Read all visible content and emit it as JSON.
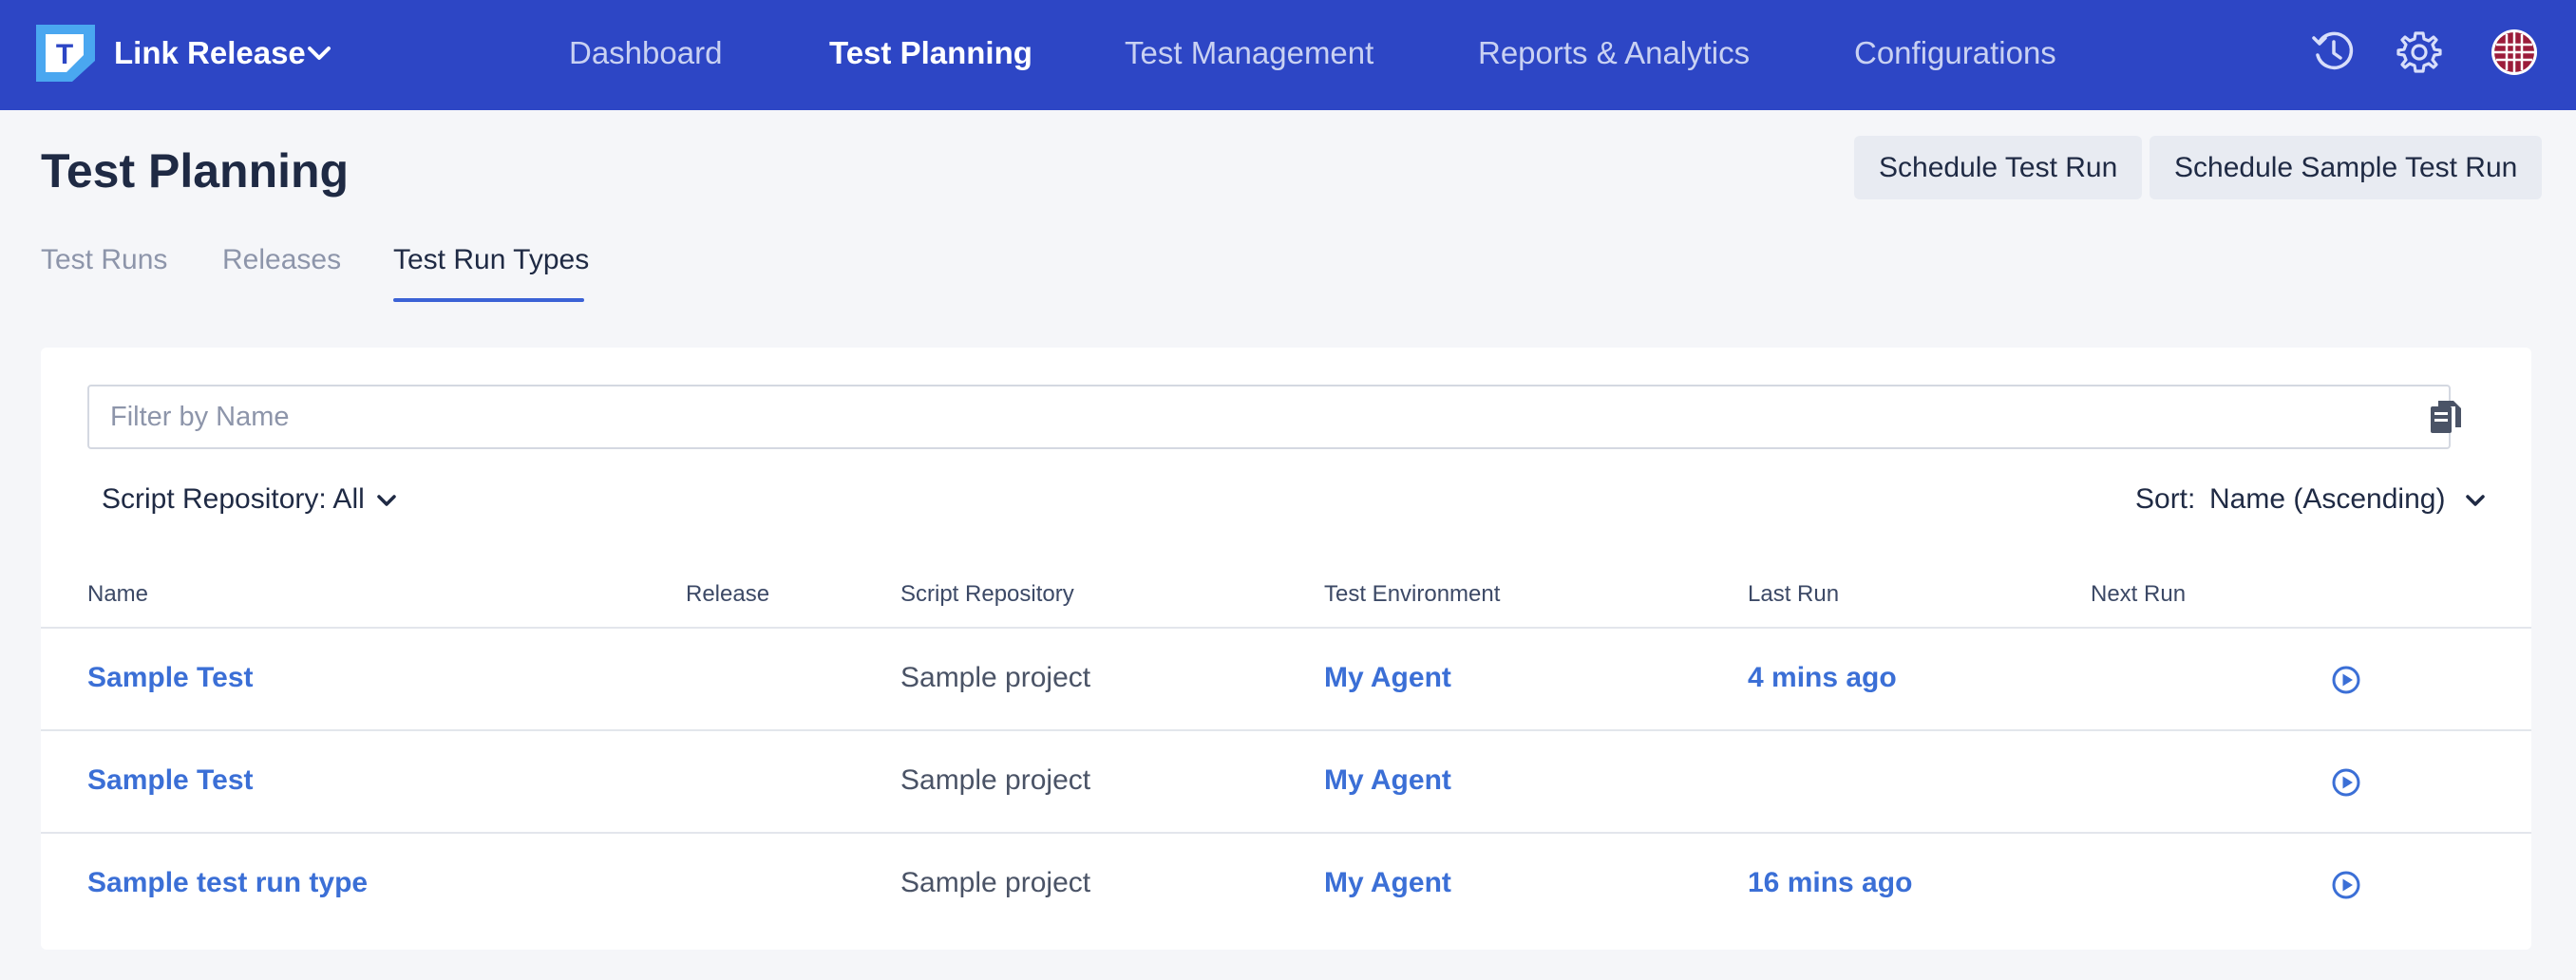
{
  "header": {
    "project_name": "Link Release",
    "nav": [
      {
        "label": "Dashboard"
      },
      {
        "label": "Test Planning"
      },
      {
        "label": "Test Management"
      },
      {
        "label": "Reports & Analytics"
      },
      {
        "label": "Configurations"
      }
    ],
    "active_nav": "Test Planning",
    "icons": [
      "history-icon",
      "gear-icon",
      "avatar"
    ],
    "colors": {
      "bar": "#2d46c5",
      "active_text": "#ffffff",
      "inactive_text": "#c9d1f2"
    }
  },
  "page": {
    "title": "Test Planning",
    "buttons": {
      "schedule_test_run": "Schedule Test Run",
      "schedule_sample_test_run": "Schedule Sample Test Run"
    },
    "tabs": [
      {
        "label": "Test Runs"
      },
      {
        "label": "Releases"
      },
      {
        "label": "Test Run Types"
      }
    ],
    "active_tab": "Test Run Types"
  },
  "filters": {
    "name_placeholder": "Filter by Name",
    "repository": "Script Repository: All",
    "sort_label": "Sort:",
    "sort_value": "Name (Ascending)"
  },
  "table": {
    "columns": [
      "Name",
      "Release",
      "Script Repository",
      "Test Environment",
      "Last Run",
      "Next Run"
    ],
    "rows": [
      {
        "name": "Sample Test",
        "release": "",
        "repository": "Sample project",
        "environment": "My Agent",
        "last_run": "4 mins ago",
        "next_run": ""
      },
      {
        "name": "Sample Test",
        "release": "",
        "repository": "Sample project",
        "environment": "My Agent",
        "last_run": "",
        "next_run": ""
      },
      {
        "name": "Sample test run type",
        "release": "",
        "repository": "Sample project",
        "environment": "My Agent",
        "last_run": "16 mins ago",
        "next_run": ""
      }
    ],
    "link_color": "#3b6fd6"
  }
}
